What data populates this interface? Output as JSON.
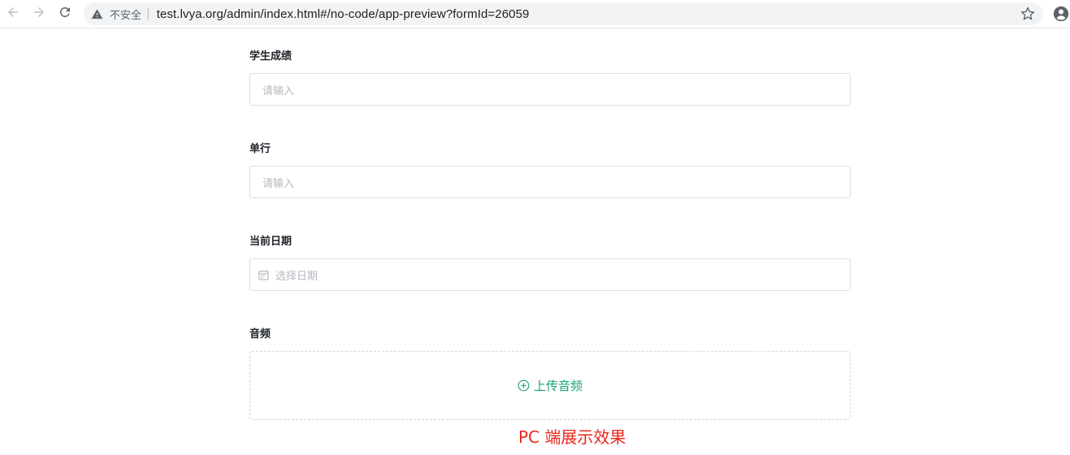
{
  "browser": {
    "security_label": "不安全",
    "separator": "|",
    "url": "test.lvya.org/admin/index.html#/no-code/app-preview?formId=26059",
    "icons": {
      "back": "arrow-left-icon",
      "forward": "arrow-right-icon",
      "reload": "reload-icon",
      "warning": "warning-triangle-icon",
      "bookmark": "star-icon",
      "profile": "account-circle-icon"
    }
  },
  "form": {
    "fields": [
      {
        "label": "学生成绩",
        "placeholder": "请输入",
        "type": "text"
      },
      {
        "label": "单行",
        "placeholder": "请输入",
        "type": "text"
      },
      {
        "label": "当前日期",
        "placeholder": "选择日期",
        "type": "date",
        "icon": "calendar-icon"
      },
      {
        "label": "音频",
        "upload_label": "上传音频",
        "type": "upload",
        "icon": "plus-circle-icon"
      }
    ]
  },
  "caption": "PC 端展示效果",
  "colors": {
    "accent": "#1aa37a",
    "caption": "#e8271c",
    "border": "#dcdfe6",
    "placeholder": "#b4b8bf"
  }
}
